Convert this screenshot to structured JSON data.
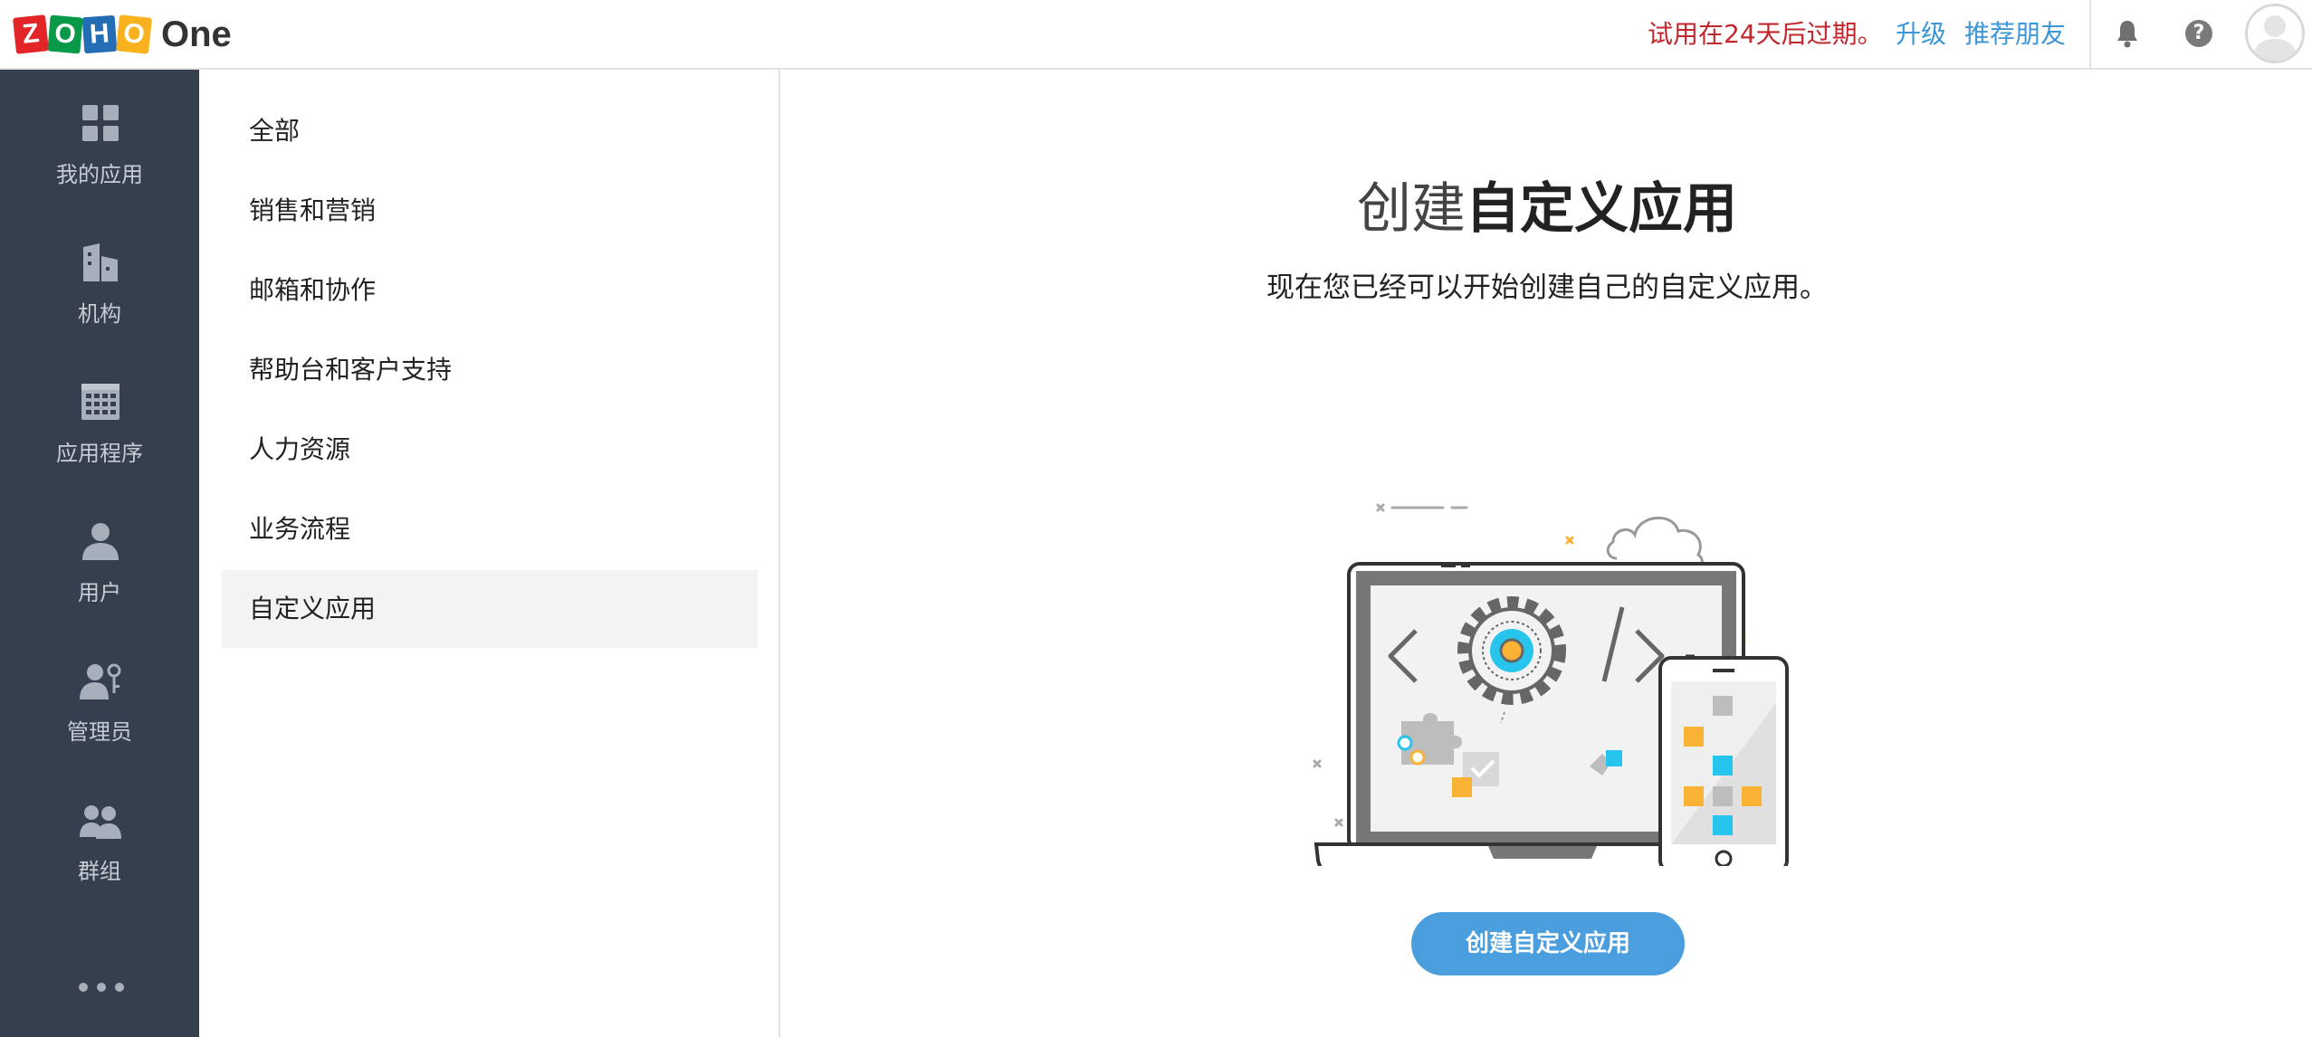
{
  "header": {
    "logo_letters": [
      "Z",
      "O",
      "H",
      "O"
    ],
    "logo_product": "One",
    "trial_notice": "试用在24天后过期。",
    "upgrade_label": "升级",
    "refer_label": "推荐朋友",
    "help_label": "?"
  },
  "leftnav": {
    "items": [
      {
        "label": "我的应用",
        "icon": "apps-grid-icon"
      },
      {
        "label": "机构",
        "icon": "building-icon"
      },
      {
        "label": "应用程序",
        "icon": "calendar-grid-icon"
      },
      {
        "label": "用户",
        "icon": "user-icon"
      },
      {
        "label": "管理员",
        "icon": "admin-key-icon"
      },
      {
        "label": "群组",
        "icon": "group-icon"
      }
    ],
    "more_icon": "more-dots-icon"
  },
  "categories": {
    "items": [
      "全部",
      "销售和营销",
      "邮箱和协作",
      "帮助台和客户支持",
      "人力资源",
      "业务流程",
      "自定义应用"
    ],
    "active_index": 6
  },
  "main": {
    "title_light": "创建",
    "title_bold": "自定义应用",
    "subtitle": "现在您已经可以开始创建自己的自定义应用。",
    "cta_label": "创建自定义应用"
  },
  "colors": {
    "nav_bg": "#353f4d",
    "accent_blue": "#4a9ede",
    "link_blue": "#3b97d8",
    "trial_red": "#c2272d",
    "illus_orange": "#f9b233",
    "illus_cyan": "#27c4ee"
  }
}
